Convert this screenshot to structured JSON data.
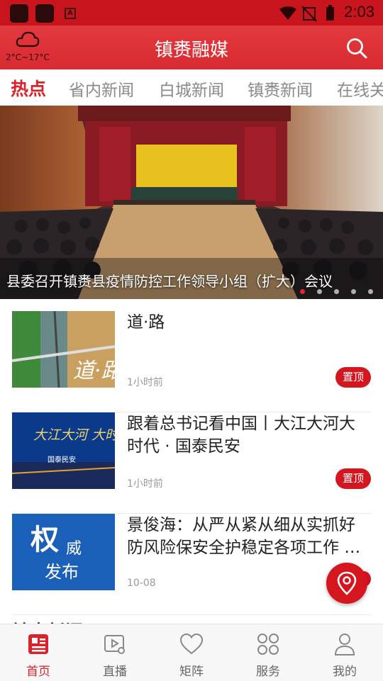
{
  "status_bar": {
    "time": "2:03"
  },
  "header": {
    "weather_temp": "2°C~17°C",
    "title": "镇赉融媒"
  },
  "tabs": [
    {
      "label": "热点",
      "active": true
    },
    {
      "label": "省内新闻"
    },
    {
      "label": "白城新闻"
    },
    {
      "label": "镇赉新闻"
    },
    {
      "label": "在线关"
    }
  ],
  "banner": {
    "caption": "县委召开镇赉县疫情防控工作领导小组（扩大）会议",
    "slide_count": 5,
    "active_slide": 1
  },
  "news": [
    {
      "title": "道·路",
      "time": "1小时前",
      "badge": "置顶",
      "thumb_text": "道·路"
    },
    {
      "title": "跟着总书记看中国丨大江大河大时代 · 国泰民安",
      "time": "1小时前",
      "badge": "置顶",
      "thumb_text": "大江大河 大时代",
      "thumb_sub": "国泰民安"
    },
    {
      "title": "景俊海：从严从紧从细从实抓好防风险保安全护稳定各项工作 …",
      "time": "10-08",
      "badge": "",
      "thumb_text": "权",
      "thumb_text2": "威",
      "thumb_text3": "发布"
    }
  ],
  "section_peek": "镇赉新闻",
  "bottom_nav": [
    {
      "label": "首页",
      "icon": "news-icon",
      "active": true
    },
    {
      "label": "直播",
      "icon": "video-icon"
    },
    {
      "label": "矩阵",
      "icon": "heart-icon"
    },
    {
      "label": "服务",
      "icon": "grid-icon"
    },
    {
      "label": "我的",
      "icon": "user-icon"
    }
  ],
  "colors": {
    "brand_red": "#d9232b",
    "status_bar": "#c8141c"
  }
}
